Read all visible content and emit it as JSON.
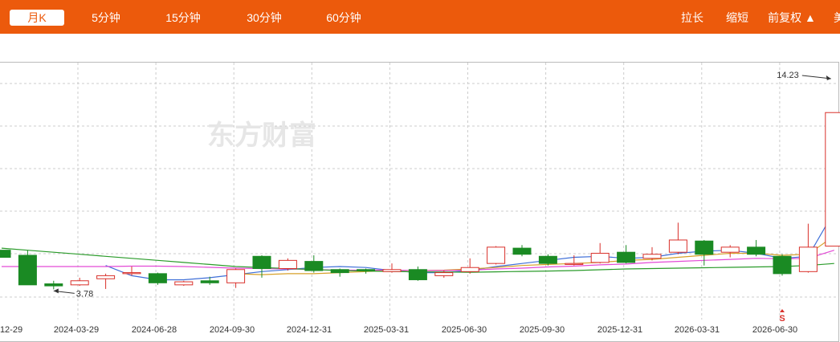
{
  "toolbar": {
    "tabs": [
      {
        "label": "月K",
        "active": true
      },
      {
        "label": "5分钟"
      },
      {
        "label": "15分钟"
      },
      {
        "label": "30分钟"
      },
      {
        "label": "60分钟"
      }
    ],
    "stretch_label": "拉长",
    "shrink_label": "缩短",
    "adjust_label": "前复权 ▲",
    "edge_label": "美"
  },
  "watermark": "东方财富",
  "colors": {
    "bar": "#ec5a0c",
    "up": "#d9302a",
    "down": "#1a8a23",
    "ma5": "#3f6fd8",
    "ma10": "#d7a12a",
    "ma20": "#e34ad6",
    "ma60": "#2a9b2a"
  },
  "chart_data": {
    "type": "candlestick",
    "ylim": [
      2.3,
      14.9
    ],
    "x_ticks": [
      "12-29",
      "2024-03-29",
      "2024-06-28",
      "2024-09-30",
      "2024-12-31",
      "2025-03-31",
      "2025-06-30",
      "2025-09-30",
      "2025-12-31",
      "2026-03-31",
      "2026-06-30"
    ],
    "annotations": [
      {
        "label": "14.23",
        "value": 14.23
      },
      {
        "label": "3.78",
        "value": 3.78
      }
    ],
    "marker_label": "S",
    "candles": [
      {
        "o": 5.7,
        "c": 5.35,
        "h": 5.7,
        "l": 5.35
      },
      {
        "o": 5.45,
        "c": 4.0,
        "h": 5.7,
        "l": 4.0
      },
      {
        "o": 4.05,
        "c": 3.95,
        "h": 4.2,
        "l": 3.78
      },
      {
        "o": 4.0,
        "c": 4.2,
        "h": 4.35,
        "l": 3.95
      },
      {
        "o": 4.3,
        "c": 4.45,
        "h": 4.55,
        "l": 3.8
      },
      {
        "o": 4.55,
        "c": 4.6,
        "h": 4.9,
        "l": 4.45
      },
      {
        "o": 4.55,
        "c": 4.1,
        "h": 4.6,
        "l": 4.0
      },
      {
        "o": 4.0,
        "c": 4.15,
        "h": 4.2,
        "l": 3.95
      },
      {
        "o": 4.2,
        "c": 4.1,
        "h": 4.4,
        "l": 4.0
      },
      {
        "o": 4.1,
        "c": 4.75,
        "h": 4.8,
        "l": 3.85
      },
      {
        "o": 5.4,
        "c": 4.8,
        "h": 5.45,
        "l": 4.35
      },
      {
        "o": 4.8,
        "c": 5.2,
        "h": 5.3,
        "l": 4.7
      },
      {
        "o": 5.15,
        "c": 4.7,
        "h": 5.45,
        "l": 4.6
      },
      {
        "o": 4.75,
        "c": 4.6,
        "h": 4.8,
        "l": 4.4
      },
      {
        "o": 4.75,
        "c": 4.7,
        "h": 4.8,
        "l": 4.55
      },
      {
        "o": 4.65,
        "c": 4.75,
        "h": 5.05,
        "l": 4.6
      },
      {
        "o": 4.75,
        "c": 4.25,
        "h": 4.9,
        "l": 4.2
      },
      {
        "o": 4.45,
        "c": 4.6,
        "h": 4.7,
        "l": 4.35
      },
      {
        "o": 4.65,
        "c": 4.85,
        "h": 5.3,
        "l": 4.55
      },
      {
        "o": 5.05,
        "c": 5.85,
        "h": 5.9,
        "l": 5.0
      },
      {
        "o": 5.8,
        "c": 5.5,
        "h": 5.95,
        "l": 5.4
      },
      {
        "o": 5.4,
        "c": 5.05,
        "h": 5.5,
        "l": 4.95
      },
      {
        "o": 5.0,
        "c": 5.05,
        "h": 5.45,
        "l": 4.95
      },
      {
        "o": 5.1,
        "c": 5.55,
        "h": 6.05,
        "l": 5.05
      },
      {
        "o": 5.6,
        "c": 5.1,
        "h": 5.95,
        "l": 5.05
      },
      {
        "o": 5.3,
        "c": 5.5,
        "h": 5.85,
        "l": 5.2
      },
      {
        "o": 5.6,
        "c": 6.2,
        "h": 7.05,
        "l": 5.5
      },
      {
        "o": 6.15,
        "c": 5.5,
        "h": 6.2,
        "l": 4.95
      },
      {
        "o": 5.6,
        "c": 5.85,
        "h": 5.95,
        "l": 5.35
      },
      {
        "o": 5.85,
        "c": 5.5,
        "h": 6.2,
        "l": 5.4
      },
      {
        "o": 5.4,
        "c": 4.55,
        "h": 5.5,
        "l": 4.45
      },
      {
        "o": 4.65,
        "c": 5.85,
        "h": 7.0,
        "l": 4.6
      },
      {
        "o": 5.9,
        "c": 12.45,
        "h": 12.45,
        "l": 5.9
      }
    ],
    "series": [
      {
        "name": "MA5",
        "values": [
          null,
          null,
          null,
          null,
          4.95,
          4.45,
          4.25,
          4.25,
          4.35,
          4.5,
          4.65,
          4.75,
          4.85,
          4.9,
          4.85,
          4.7,
          4.6,
          4.6,
          4.7,
          4.9,
          5.05,
          5.2,
          5.35,
          5.4,
          5.3,
          5.35,
          5.55,
          5.65,
          5.7,
          5.55,
          5.3,
          5.4,
          7.6
        ]
      },
      {
        "name": "MA10",
        "values": [
          null,
          null,
          null,
          null,
          null,
          null,
          null,
          null,
          null,
          4.55,
          4.5,
          4.55,
          4.55,
          4.6,
          4.65,
          4.7,
          4.7,
          4.72,
          4.78,
          4.85,
          4.95,
          5.0,
          5.05,
          5.1,
          5.2,
          5.25,
          5.35,
          5.45,
          5.55,
          5.55,
          5.45,
          5.5,
          6.4
        ]
      },
      {
        "name": "MA20",
        "values": [
          4.9,
          4.9,
          4.9,
          4.9,
          4.9,
          4.92,
          4.92,
          4.9,
          4.86,
          4.82,
          4.8,
          4.78,
          4.75,
          4.72,
          4.72,
          4.72,
          4.7,
          4.7,
          4.72,
          4.78,
          4.82,
          4.88,
          4.92,
          4.98,
          5.02,
          5.1,
          5.15,
          5.2,
          5.25,
          5.3,
          5.28,
          5.3,
          5.7
        ]
      },
      {
        "name": "MA60",
        "values": [
          5.8,
          5.7,
          5.6,
          5.5,
          5.4,
          5.3,
          5.2,
          5.1,
          5.0,
          4.9,
          4.85,
          4.8,
          4.75,
          4.7,
          4.68,
          4.66,
          4.64,
          4.63,
          4.62,
          4.64,
          4.66,
          4.68,
          4.7,
          4.74,
          4.78,
          4.8,
          4.82,
          4.84,
          4.86,
          4.88,
          4.9,
          4.95,
          5.05
        ]
      }
    ]
  }
}
